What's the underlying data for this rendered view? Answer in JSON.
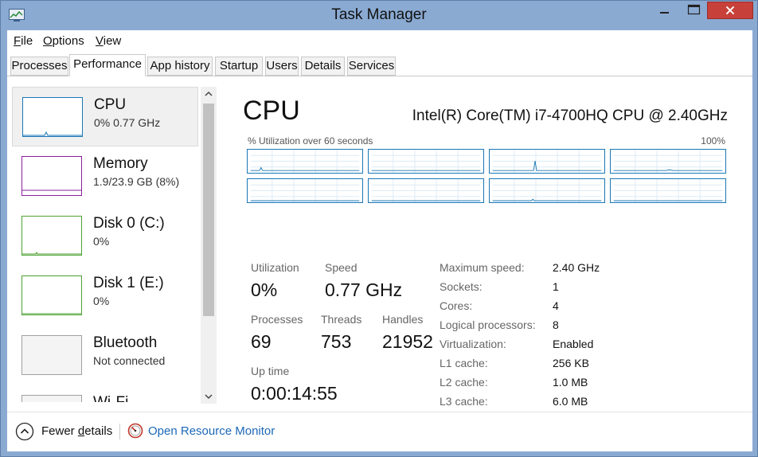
{
  "window": {
    "title": "Task Manager",
    "icon": "task-manager-icon",
    "close_color": "#c7413a"
  },
  "menu": [
    {
      "label": "File",
      "underline": "F"
    },
    {
      "label": "Options",
      "underline": "O"
    },
    {
      "label": "View",
      "underline": "V"
    }
  ],
  "tabs": [
    {
      "label": "Processes"
    },
    {
      "label": "Performance",
      "active": true
    },
    {
      "label": "App history"
    },
    {
      "label": "Startup"
    },
    {
      "label": "Users"
    },
    {
      "label": "Details"
    },
    {
      "label": "Services"
    }
  ],
  "sidebar": {
    "items": [
      {
        "title": "CPU",
        "subtitle": "0%  0.77 GHz",
        "color": "#1a77b6",
        "selected": true
      },
      {
        "title": "Memory",
        "subtitle": "1.9/23.9 GB (8%)",
        "color": "#8b1e9c"
      },
      {
        "title": "Disk 0 (C:)",
        "subtitle": "0%",
        "color": "#4da233"
      },
      {
        "title": "Disk 1 (E:)",
        "subtitle": "0%",
        "color": "#4da233"
      },
      {
        "title": "Bluetooth",
        "subtitle": "Not connected",
        "color": "#a0a0a0"
      },
      {
        "title": "Wi-Fi",
        "subtitle": "",
        "color": "#a0a0a0"
      }
    ]
  },
  "cpu": {
    "heading": "CPU",
    "model": "Intel(R) Core(TM) i7-4700HQ CPU @ 2.40GHz",
    "graph_label": "% Utilization over 60 seconds",
    "graph_max": "100%",
    "accent": "#1a77b6",
    "stats": {
      "utilization_label": "Utilization",
      "utilization": "0%",
      "speed_label": "Speed",
      "speed": "0.77 GHz",
      "processes_label": "Processes",
      "processes": "69",
      "threads_label": "Threads",
      "threads": "753",
      "handles_label": "Handles",
      "handles": "21952",
      "uptime_label": "Up time",
      "uptime": "0:00:14:55"
    },
    "specs": [
      {
        "label": "Maximum speed:",
        "value": "2.40 GHz"
      },
      {
        "label": "Sockets:",
        "value": "1"
      },
      {
        "label": "Cores:",
        "value": "4"
      },
      {
        "label": "Logical processors:",
        "value": "8"
      },
      {
        "label": "Virtualization:",
        "value": "Enabled"
      },
      {
        "label": "L1 cache:",
        "value": "256 KB"
      },
      {
        "label": "L2 cache:",
        "value": "1.0 MB"
      },
      {
        "label": "L3 cache:",
        "value": "6.0 MB"
      }
    ]
  },
  "footer": {
    "fewer_details": "Fewer details",
    "fewer_underline": "d",
    "resource_monitor": "Open Resource Monitor"
  }
}
